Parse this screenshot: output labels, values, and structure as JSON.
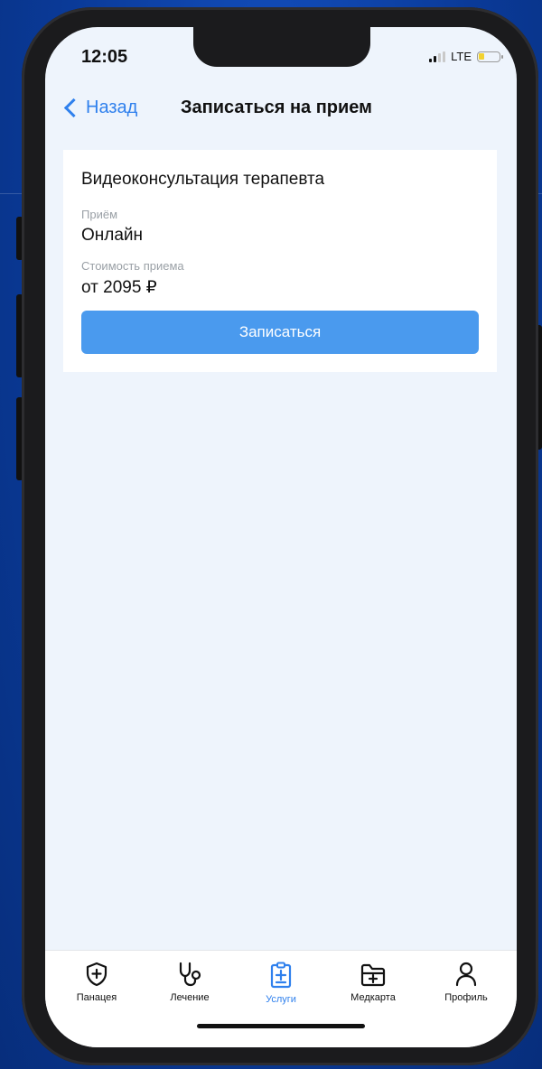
{
  "status": {
    "time": "12:05",
    "network": "LTE"
  },
  "nav": {
    "back_label": "Назад",
    "title": "Записаться на прием"
  },
  "service": {
    "title": "Видеоконсультация терапевта",
    "type_label": "Приём",
    "type_value": "Онлайн",
    "price_label": "Стоимость приема",
    "price_value": "от 2095 ₽",
    "cta_label": "Записаться"
  },
  "tabbar": {
    "active": "Услуги",
    "items": [
      {
        "label": "Панацея",
        "icon": "shield-plus-icon"
      },
      {
        "label": "Лечение",
        "icon": "stethoscope-icon"
      },
      {
        "label": "Услуги",
        "icon": "clipboard-plus-icon"
      },
      {
        "label": "Медкарта",
        "icon": "folder-plus-icon"
      },
      {
        "label": "Профиль",
        "icon": "person-icon"
      }
    ]
  },
  "colors": {
    "accent": "#2f80ed",
    "button": "#4a9aee",
    "screen_bg": "#eef4fc",
    "backdrop": "#0b3fa0"
  }
}
